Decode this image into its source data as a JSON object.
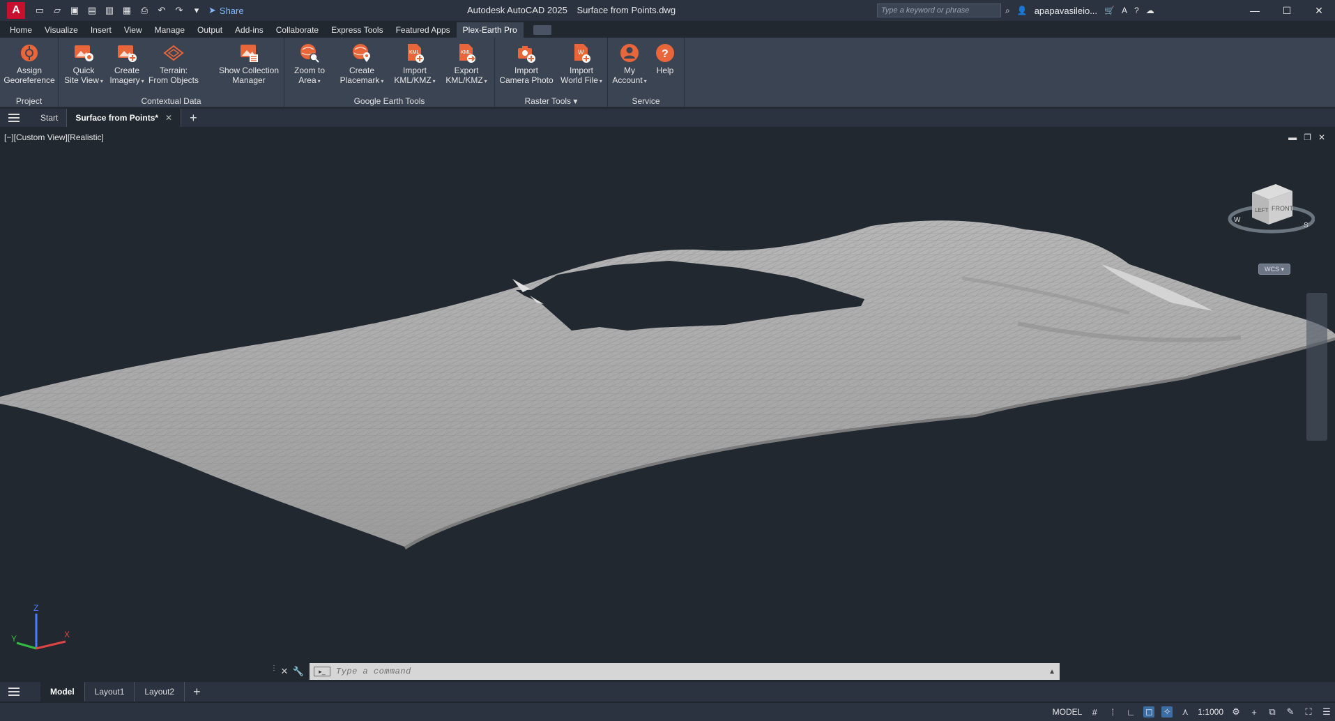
{
  "app": {
    "logo_letter": "A",
    "title": "Autodesk AutoCAD 2025",
    "filename": "Surface from Points.dwg",
    "share_label": "Share",
    "search_placeholder": "Type a keyword or phrase",
    "user": "apapavasileio..."
  },
  "ribbon_tabs": [
    "Home",
    "Visualize",
    "Insert",
    "View",
    "Manage",
    "Output",
    "Add-ins",
    "Collaborate",
    "Express Tools",
    "Featured Apps",
    "Plex-Earth Pro"
  ],
  "active_ribbon_tab": "Plex-Earth Pro",
  "panels": {
    "project": {
      "label": "Project",
      "buttons": [
        {
          "label": "Assign\nGeoreference",
          "icon": "georeference-icon"
        }
      ]
    },
    "contextual": {
      "label": "Contextual Data",
      "buttons": [
        {
          "label": "Quick\nSite View",
          "icon": "quick-site-view-icon"
        },
        {
          "label": "Create\nImagery",
          "icon": "create-imagery-icon"
        },
        {
          "label": "Terrain:\nFrom Objects",
          "icon": "terrain-icon"
        },
        {
          "label": "Show Collection\nManager",
          "icon": "collection-manager-icon"
        }
      ]
    },
    "google_earth": {
      "label": "Google Earth Tools",
      "buttons": [
        {
          "label": "Zoom to\nArea",
          "icon": "zoom-area-icon"
        },
        {
          "label": "Create\nPlacemark",
          "icon": "placemark-icon"
        },
        {
          "label": "Import\nKML/KMZ",
          "icon": "import-kml-icon"
        },
        {
          "label": "Export\nKML/KMZ",
          "icon": "export-kml-icon"
        }
      ]
    },
    "raster": {
      "label": "Raster Tools",
      "buttons": [
        {
          "label": "Import\nCamera Photo",
          "icon": "camera-photo-icon"
        },
        {
          "label": "Import\nWorld File",
          "icon": "world-file-icon"
        }
      ]
    },
    "service": {
      "label": "Service",
      "buttons": [
        {
          "label": "My\nAccount",
          "icon": "account-icon"
        },
        {
          "label": "Help",
          "icon": "help-icon"
        }
      ]
    }
  },
  "file_tabs": {
    "start": "Start",
    "active": "Surface from Points*"
  },
  "viewport": {
    "label": "[−][Custom View][Realistic]",
    "viewcube_left": "LEFT",
    "viewcube_front": "FRONT",
    "compass_w": "W",
    "compass_s": "S",
    "wcs": "WCS",
    "ucs_x": "X",
    "ucs_y": "Y",
    "ucs_z": "Z"
  },
  "command": {
    "placeholder": "Type a command"
  },
  "layout_tabs": [
    "Model",
    "Layout1",
    "Layout2"
  ],
  "status": {
    "model": "MODEL",
    "scale": "1:1000"
  },
  "colors": {
    "accent": "#e8663a",
    "background": "#212830",
    "ribbon": "#3b4453",
    "surface": "#a8a8a8"
  }
}
